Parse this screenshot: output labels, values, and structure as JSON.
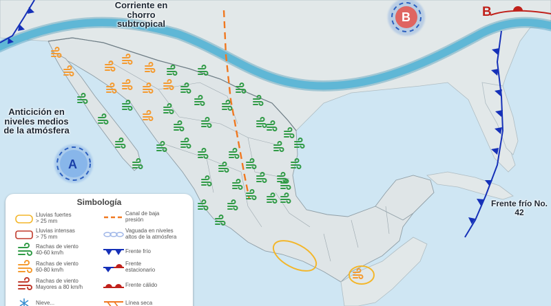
{
  "labels": {
    "jet_stream": "Corriente en chorro subtropical",
    "anticyclone": "Anticición en niveles medios de la atmósfera",
    "cold_front": "Frente frío No. 42"
  },
  "pressure_systems": {
    "high": "A",
    "low_center": "B",
    "low_east": "B"
  },
  "legend": {
    "title": "Simbología",
    "items": [
      {
        "text": "Lluvias fuertes\n> 25 mm",
        "icon": "yellow-oval"
      },
      {
        "text": "Lluvias intensas\n> 75 mm",
        "icon": "red-oval"
      },
      {
        "text": "Rachas de viento\n40-60 km/h",
        "icon": "green-wind"
      },
      {
        "text": "Rachas de viento\n60-80 km/h",
        "icon": "orange-wind"
      },
      {
        "text": "Rachas de viento\nMayores a 80 km/h",
        "icon": "red-wind"
      },
      {
        "text": "Nieve...",
        "icon": "snowflake"
      },
      {
        "text": "Canal de baja\npresión",
        "icon": "orange-dashed-line"
      },
      {
        "text": "Vaguada en niveles\naltos de la atmósfera",
        "icon": "blue-chain-line"
      },
      {
        "text": "Frente frío",
        "icon": "cold-front"
      },
      {
        "text": "Frente\nestacionario",
        "icon": "stationary-front"
      },
      {
        "text": "Frente cálido",
        "icon": "warm-front"
      },
      {
        "text": "Línea seca",
        "icon": "dry-line"
      }
    ]
  },
  "colors": {
    "ocean": "#cfe6f3",
    "land": "#dbe3e6",
    "jet_stream": "#5fb7d6",
    "cold_front": "#1530b8",
    "warm_front": "#c0201a",
    "trough_line": "#f07820",
    "wind_green": "#2f9a45",
    "wind_orange": "#f59a2e",
    "wind_red": "#c0392b",
    "rain_yellow": "#f3b62a"
  }
}
